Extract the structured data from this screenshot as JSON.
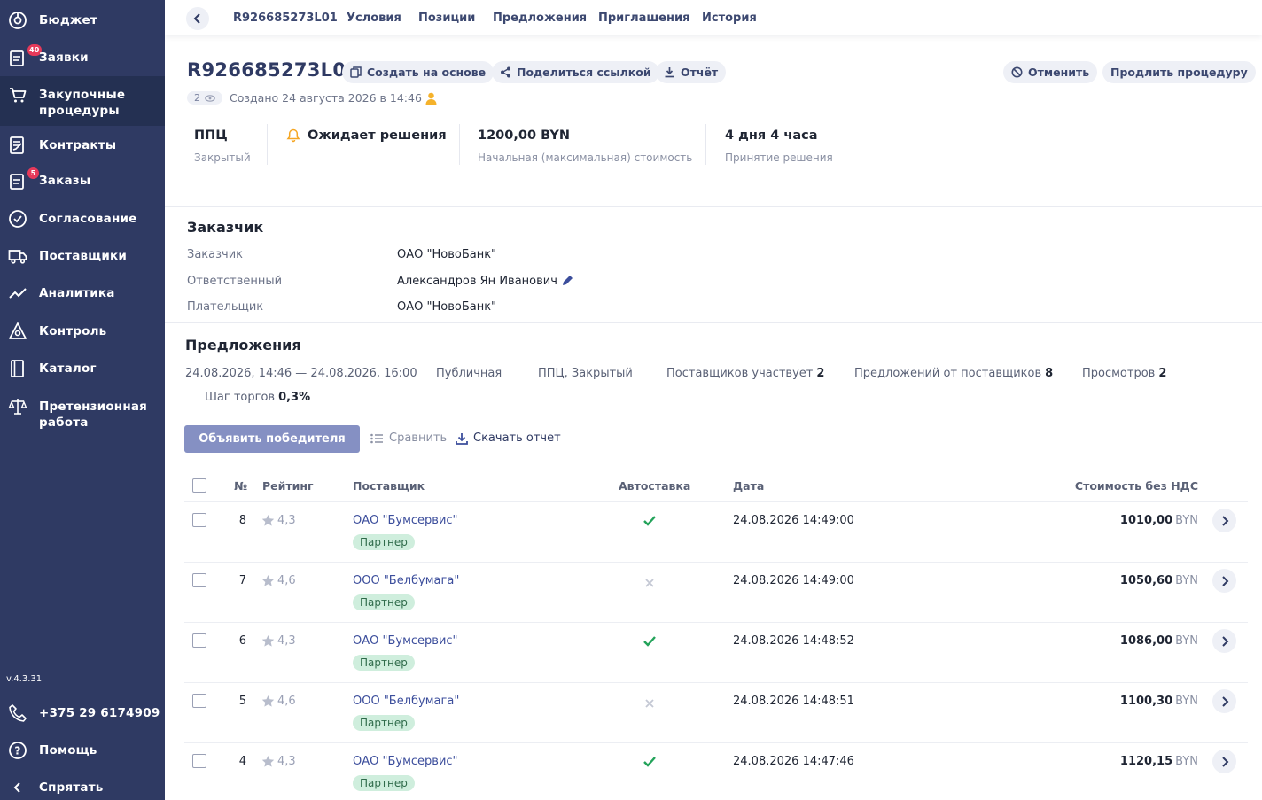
{
  "sidebar": {
    "items": [
      {
        "label": "Бюджет",
        "icon": "budget-icon"
      },
      {
        "label": "Заявки",
        "icon": "requests-icon",
        "badge": "40"
      },
      {
        "label": "Закупочные процедуры",
        "icon": "cart-icon"
      },
      {
        "label": "Контракты",
        "icon": "contract-icon"
      },
      {
        "label": "Заказы",
        "icon": "orders-icon",
        "badge": "5"
      },
      {
        "label": "Согласование",
        "icon": "check-circle-icon"
      },
      {
        "label": "Поставщики",
        "icon": "truck-icon"
      },
      {
        "label": "Аналитика",
        "icon": "analytics-icon"
      },
      {
        "label": "Контроль",
        "icon": "control-icon"
      },
      {
        "label": "Каталог",
        "icon": "catalog-icon"
      },
      {
        "label": "Претензионная работа",
        "icon": "scales-icon"
      }
    ],
    "version": "v.4.3.31",
    "phone": "+375 29 6174909",
    "help": "Помощь",
    "hide": "Спрятать"
  },
  "tabs": [
    "R926685273L01",
    "Условия",
    "Позиции",
    "Предложения",
    "Приглашения",
    "История"
  ],
  "header": {
    "id": "R926685273L01",
    "create_based": "Создать на основе",
    "share_link": "Поделиться ссылкой",
    "report": "Отчёт",
    "cancel": "Отменить",
    "extend": "Продлить процедуру",
    "views_count": "2",
    "created": "Создано 24 августа 2026 в 14:46"
  },
  "summary": {
    "type": "ППЦ",
    "type_sub": "Закрытый",
    "status": "Ожидает решения",
    "cost": "1200,00 BYN",
    "cost_sub": "Начальная (максимальная) стоимость",
    "time": "4 дня 4 часа",
    "time_sub": "Принятие решения"
  },
  "customer": {
    "title": "Заказчик",
    "rows": [
      {
        "label": "Заказчик",
        "value": "ОАО \"НовоБанк\""
      },
      {
        "label": "Ответственный",
        "value": "Александров Ян Иванович"
      },
      {
        "label": "Плательщик",
        "value": "ОАО \"НовоБанк\""
      }
    ]
  },
  "offers": {
    "title": "Предложения",
    "period": "24.08.2026, 14:46 — 24.08.2026, 16:00",
    "visibility": "Публичная",
    "kind": "ППЦ, Закрытый",
    "suppliers_label": "Поставщиков участвует",
    "suppliers_value": "2",
    "offers_label": "Предложений от поставщиков",
    "offers_value": "8",
    "views_label": "Просмотров",
    "views_value": "2",
    "step_label": "Шаг торгов",
    "step_value": "0,3%",
    "declare_winner": "Объявить победителя",
    "compare": "Сравнить",
    "download_report": "Скачать отчет"
  },
  "table": {
    "headers": {
      "num": "№",
      "rating": "Рейтинг",
      "supplier": "Поставщик",
      "auto": "Автоставка",
      "date": "Дата",
      "price": "Стоимость без НДС"
    },
    "rows": [
      {
        "num": "8",
        "rating": "4,3",
        "supplier": "ОАО \"Бумсервис\"",
        "tag": "Партнер",
        "auto": true,
        "date": "24.08.2026 14:49:00",
        "price": "1010,00",
        "currency": "BYN"
      },
      {
        "num": "7",
        "rating": "4,6",
        "supplier": "ООО \"Белбумага\"",
        "tag": "Партнер",
        "auto": false,
        "date": "24.08.2026 14:49:00",
        "price": "1050,60",
        "currency": "BYN"
      },
      {
        "num": "6",
        "rating": "4,3",
        "supplier": "ОАО \"Бумсервис\"",
        "tag": "Партнер",
        "auto": true,
        "date": "24.08.2026 14:48:52",
        "price": "1086,00",
        "currency": "BYN"
      },
      {
        "num": "5",
        "rating": "4,6",
        "supplier": "ООО \"Белбумага\"",
        "tag": "Партнер",
        "auto": false,
        "date": "24.08.2026 14:48:51",
        "price": "1100,30",
        "currency": "BYN"
      },
      {
        "num": "4",
        "rating": "4,3",
        "supplier": "ОАО \"Бумсервис\"",
        "tag": "Партнер",
        "auto": true,
        "date": "24.08.2026 14:47:46",
        "price": "1120,15",
        "currency": "BYN"
      }
    ]
  },
  "colors": {
    "sidebar": "#2f3a63",
    "accent": "#3c4e9c",
    "primary_button": "#8590c3",
    "badge": "#e6395a",
    "success": "#23a35a",
    "partner_bg": "#cfeedd"
  }
}
